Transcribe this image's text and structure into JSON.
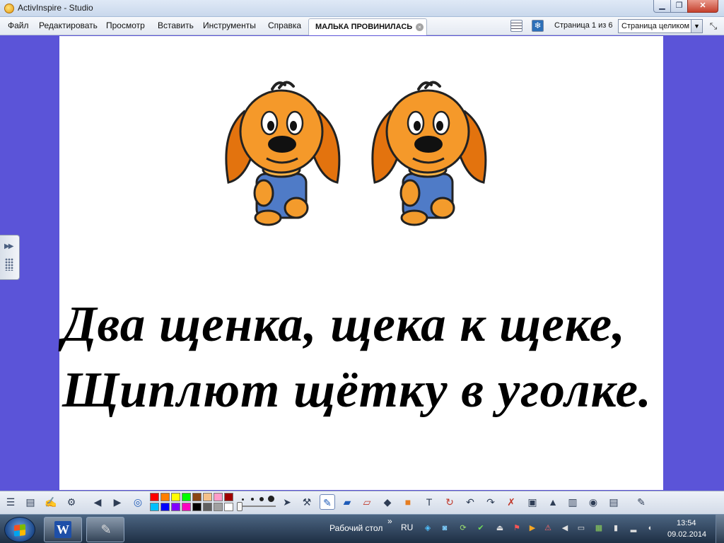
{
  "window": {
    "title": "ActivInspire - Studio",
    "min_glyph": "▁",
    "max_glyph": "❐",
    "close_glyph": "✕"
  },
  "menu": {
    "items": [
      "Файл",
      "Редактировать",
      "Просмотр",
      "Вставить",
      "Инструменты",
      "Справка"
    ]
  },
  "document_tab": {
    "label": "МАЛЬКА ПРОВИНИЛАСЬ",
    "close_glyph": "×"
  },
  "page_nav": {
    "counter": "Страница 1 из 6",
    "zoom_value": "Страница целиком",
    "zoom_arrow": "▼",
    "fullscreen_glyph": "⤡"
  },
  "flipchart": {
    "line1": "Два щенка, щека к щеке,",
    "line2": "Щиплют щётку в уголке."
  },
  "side_handle": {
    "arrows": "▶▶"
  },
  "toolbox": {
    "colors": [
      "#ff0000",
      "#ff7f00",
      "#ffff00",
      "#00ff00",
      "#8b4513",
      "#f4c08a",
      "#ff9cc8",
      "#a00000",
      "#00c0ff",
      "#0000ff",
      "#8000ff",
      "#ff00c0",
      "#000000",
      "#606060",
      "#a0a0a0",
      "#ffffff"
    ],
    "tools": [
      {
        "name": "main-menu-icon",
        "glyph": "☰"
      },
      {
        "name": "browser-icon",
        "glyph": "▤"
      },
      {
        "name": "signature-icon",
        "glyph": "✍"
      },
      {
        "name": "settings-icon",
        "glyph": "⚙"
      },
      {
        "name": "prev-page-icon",
        "glyph": "◀"
      },
      {
        "name": "next-page-icon",
        "glyph": "▶"
      },
      {
        "name": "globe-icon",
        "glyph": "◎"
      },
      {
        "name": "select-icon",
        "glyph": "➤"
      },
      {
        "name": "tools-icon",
        "glyph": "⚒"
      },
      {
        "name": "pen-icon",
        "glyph": "✎"
      },
      {
        "name": "highlighter-icon",
        "glyph": "▰"
      },
      {
        "name": "eraser-icon",
        "glyph": "▱"
      },
      {
        "name": "fill-icon",
        "glyph": "◆"
      },
      {
        "name": "shape-icon",
        "glyph": "■"
      },
      {
        "name": "text-icon",
        "glyph": "T"
      },
      {
        "name": "reset-page-icon",
        "glyph": "↻"
      },
      {
        "name": "undo-icon",
        "glyph": "↶"
      },
      {
        "name": "redo-icon",
        "glyph": "↷"
      },
      {
        "name": "clear-icon",
        "glyph": "✗"
      },
      {
        "name": "camera-icon",
        "glyph": "▣"
      },
      {
        "name": "insert-media-icon",
        "glyph": "▲"
      },
      {
        "name": "page-properties-icon",
        "glyph": "▥"
      },
      {
        "name": "spinner-icon",
        "glyph": "◉"
      },
      {
        "name": "notes-icon",
        "glyph": "▤"
      },
      {
        "name": "handwriting-icon",
        "glyph": "✎"
      }
    ]
  },
  "taskbar": {
    "desktop_label": "Рабочий стол",
    "chevron": "»",
    "lang": "RU",
    "time": "13:54",
    "date": "09.02.2014",
    "word_letter": "W",
    "inspire_glyph": "✎"
  },
  "tray_icons": [
    {
      "name": "tray-network-icon",
      "glyph": "◈",
      "color": "#4fc0ff"
    },
    {
      "name": "tray-app-icon",
      "glyph": "◙",
      "color": "#7fd0ff"
    },
    {
      "name": "tray-sync-icon",
      "glyph": "⟳",
      "color": "#9de070"
    },
    {
      "name": "tray-shield-icon",
      "glyph": "✔",
      "color": "#6fdc5a"
    },
    {
      "name": "tray-usb-icon",
      "glyph": "⏏",
      "color": "#e0e0e0"
    },
    {
      "name": "tray-flag-icon",
      "glyph": "⚑",
      "color": "#ff5555"
    },
    {
      "name": "tray-media-icon",
      "glyph": "▶",
      "color": "#f5a623"
    },
    {
      "name": "tray-update-icon",
      "glyph": "⚠",
      "color": "#ff6a6a"
    },
    {
      "name": "tray-sound-icon",
      "glyph": "◀",
      "color": "#e0e0e0"
    },
    {
      "name": "tray-monitor-icon",
      "glyph": "▭",
      "color": "#e0e0e0"
    },
    {
      "name": "tray-package-icon",
      "glyph": "▦",
      "color": "#8fd35a"
    },
    {
      "name": "tray-power-icon",
      "glyph": "▮",
      "color": "#e0e0e0"
    },
    {
      "name": "tray-signal-icon",
      "glyph": "▂",
      "color": "#e0e0e0"
    },
    {
      "name": "tray-volume-icon",
      "glyph": "◐",
      "color": "#e0e0e0"
    }
  ]
}
